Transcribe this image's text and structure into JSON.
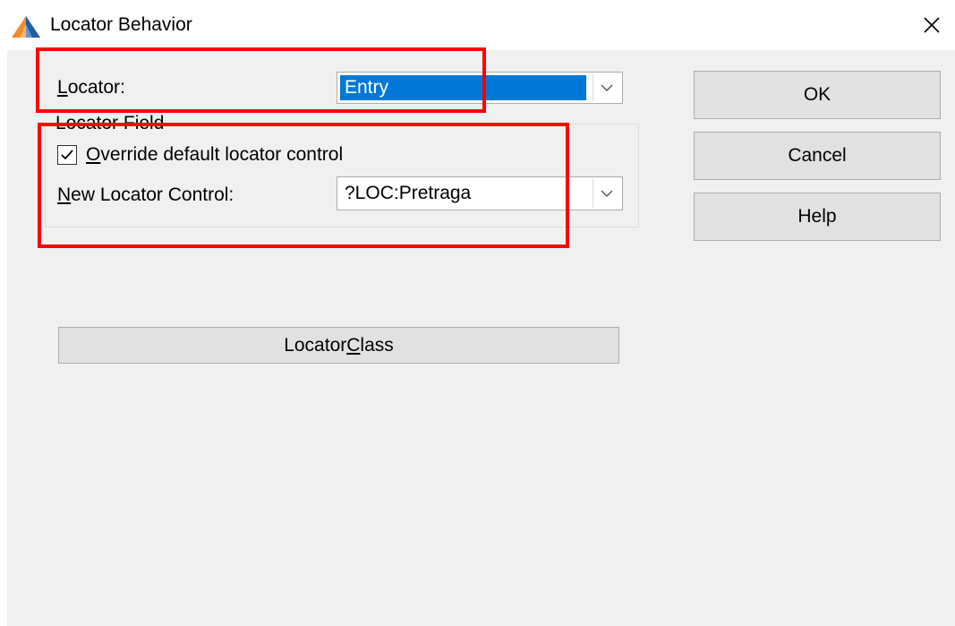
{
  "window": {
    "title": "Locator Behavior",
    "close_glyph": "✕"
  },
  "locator": {
    "label_accel": "L",
    "label_rest": "ocator:",
    "value": "Entry"
  },
  "locator_field": {
    "group_title": "Locator Field",
    "override": {
      "checked": true,
      "label_accel": "O",
      "label_rest": "verride default locator control"
    },
    "new_control": {
      "label_accel": "N",
      "label_rest": "ew Locator Control:",
      "value": "?LOC:Pretraga"
    }
  },
  "buttons": {
    "ok": "OK",
    "cancel": "Cancel",
    "help": "Help",
    "locator_class_pre": "Locator ",
    "locator_class_accel": "C",
    "locator_class_post": "lass"
  },
  "icons": {
    "app": "app-triangle-icon",
    "close": "close-icon",
    "dropdown": "chevron-down-icon",
    "check": "checkmark-icon"
  },
  "colors": {
    "selection": "#0078d7",
    "highlight_box": "#ff0000",
    "dialog_bg": "#f0f0f0"
  }
}
